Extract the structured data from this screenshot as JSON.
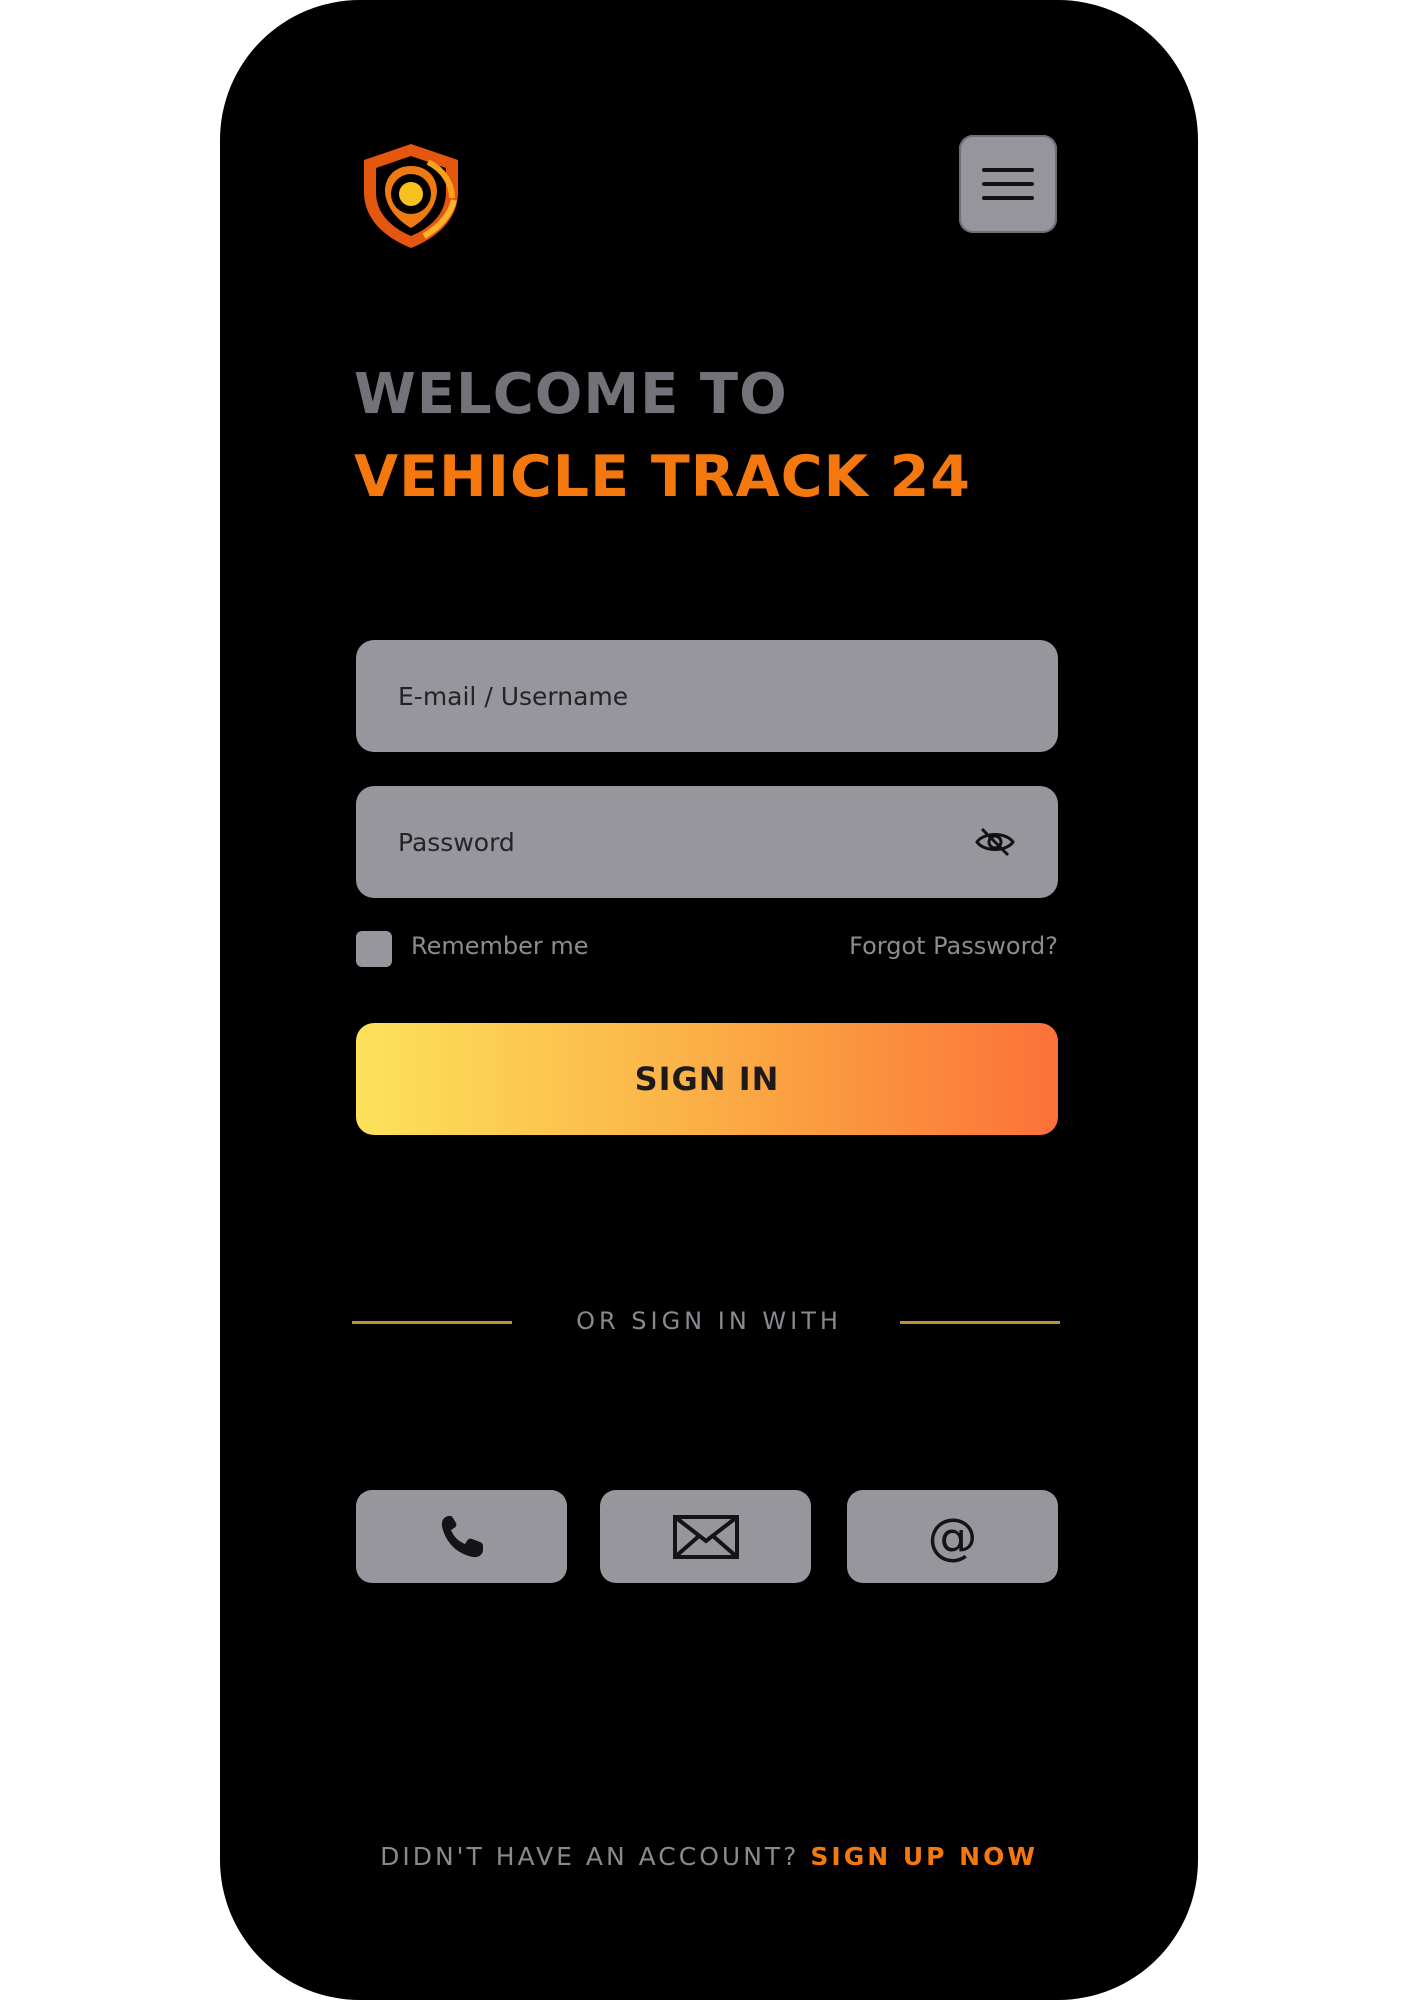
{
  "header": {
    "logo": "shield-location-logo",
    "menu_icon": "hamburger-menu-icon"
  },
  "welcome": {
    "line1": "WELCOME TO",
    "line2": "VEHICLE TRACK 24"
  },
  "form": {
    "email_placeholder": "E-mail / Username",
    "password_placeholder": "Password",
    "password_toggle_icon": "eye-slash-icon",
    "remember_label": "Remember me",
    "forgot_label": "Forgot Password?",
    "signin_label": "SIGN IN"
  },
  "alt_signin": {
    "divider_text": "OR SIGN IN WITH",
    "options": [
      {
        "icon": "phone-icon"
      },
      {
        "icon": "mail-icon"
      },
      {
        "icon": "at-icon",
        "glyph": "@"
      }
    ]
  },
  "footer": {
    "prompt": "DIDN'T HAVE AN ACCOUNT?",
    "link": "SIGN UP NOW"
  },
  "colors": {
    "brand_orange": "#f5780e",
    "background": "#000000",
    "field_gray": "#97969d",
    "button_gradient_start": "#fde25a",
    "button_gradient_end": "#fc7139",
    "divider_gold": "#b9923a"
  }
}
